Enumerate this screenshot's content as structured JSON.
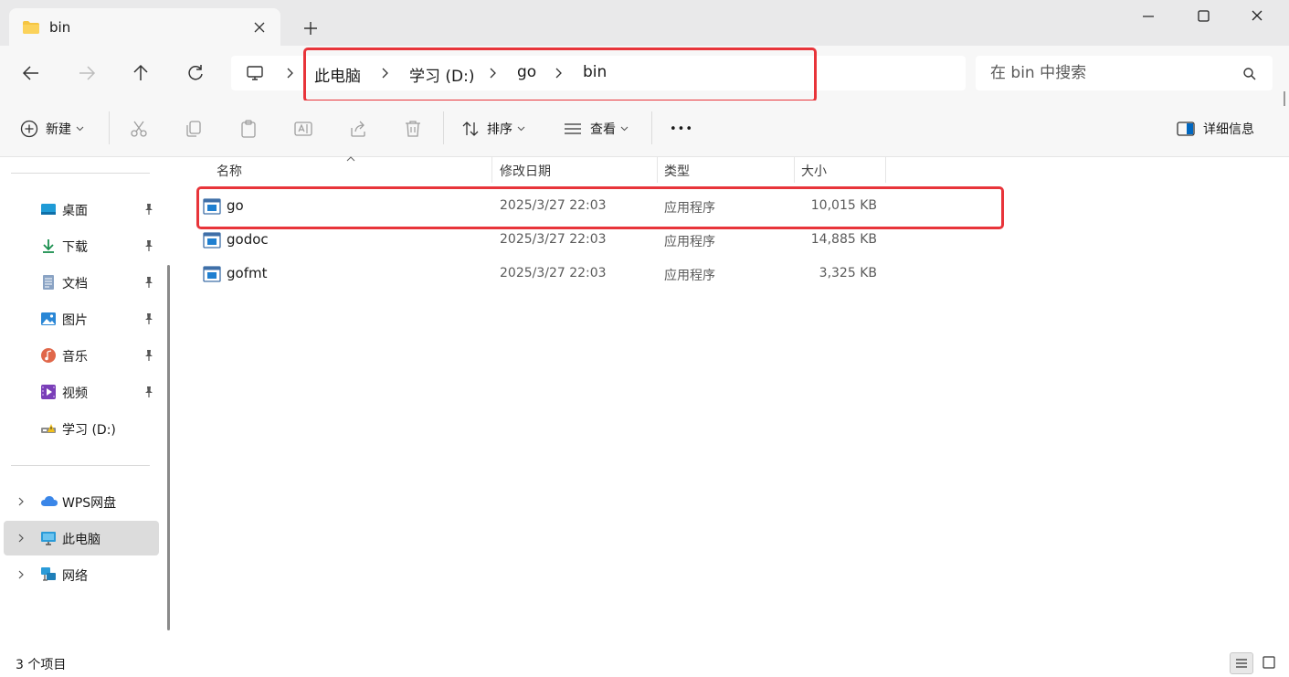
{
  "window": {
    "tab_title": "bin",
    "new_tab_symbol": "+"
  },
  "address_bar": {
    "crumbs": [
      "此电脑",
      "学习 (D:)",
      "go",
      "bin"
    ]
  },
  "search": {
    "placeholder": "在 bin 中搜索"
  },
  "toolbar": {
    "new_label": "新建",
    "sort_label": "排序",
    "view_label": "查看",
    "more_symbol": "•••",
    "details_label": "详细信息"
  },
  "sidebar": {
    "quick_access": [
      {
        "label": "桌面",
        "icon": "desktop-icon",
        "pinned": true
      },
      {
        "label": "下载",
        "icon": "download-icon",
        "pinned": true
      },
      {
        "label": "文档",
        "icon": "document-icon",
        "pinned": true
      },
      {
        "label": "图片",
        "icon": "pictures-icon",
        "pinned": true
      },
      {
        "label": "音乐",
        "icon": "music-icon",
        "pinned": true
      },
      {
        "label": "视频",
        "icon": "video-icon",
        "pinned": true
      },
      {
        "label": "学习 (D:)",
        "icon": "drive-icon",
        "pinned": false
      }
    ],
    "locations": [
      {
        "label": "WPS网盘",
        "icon": "cloud-icon",
        "active": false
      },
      {
        "label": "此电脑",
        "icon": "computer-icon",
        "active": true
      },
      {
        "label": "网络",
        "icon": "network-icon",
        "active": false
      }
    ]
  },
  "file_list": {
    "columns": [
      "名称",
      "修改日期",
      "类型",
      "大小"
    ],
    "rows": [
      {
        "name": "go",
        "date": "2025/3/27 22:03",
        "type": "应用程序",
        "size": "10,015 KB"
      },
      {
        "name": "godoc",
        "date": "2025/3/27 22:03",
        "type": "应用程序",
        "size": "14,885 KB"
      },
      {
        "name": "gofmt",
        "date": "2025/3/27 22:03",
        "type": "应用程序",
        "size": "3,325 KB"
      }
    ]
  },
  "status": {
    "item_count": "3 个项目"
  },
  "colors": {
    "highlight": "#e8343a",
    "accent": "#0067c0",
    "folder": "#f5c542"
  }
}
